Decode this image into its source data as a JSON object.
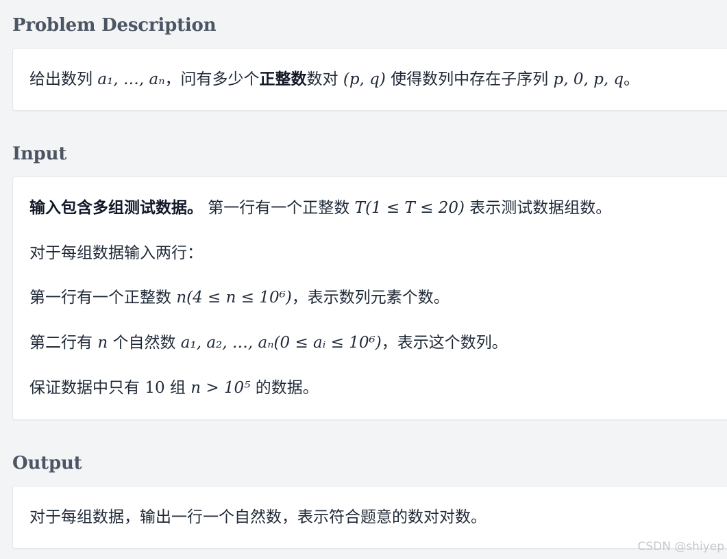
{
  "problem": {
    "title": "Problem Description",
    "text_1": "给出数列 ",
    "math_seq": "a₁, …, aₙ",
    "text_2": "，问有多少个",
    "bold": "正整数",
    "text_3": "数对 ",
    "math_pair": "(p, q)",
    "text_4": " 使得数列中存在子序列 ",
    "math_subseq": "p, 0, p, q",
    "text_5": "。"
  },
  "input": {
    "title": "Input",
    "l1_bold": "输入包含多组测试数据。",
    "l1_text": " 第一行有一个正整数 ",
    "l1_math": "T(1 ≤ T ≤ 20)",
    "l1_text2": " 表示测试数据组数。",
    "l2": "对于每组数据输入两行：",
    "l3_text": "第一行有一个正整数 ",
    "l3_math": "n(4 ≤ n ≤ 10⁶)",
    "l3_text2": "，表示数列元素个数。",
    "l4_text": "第二行有 ",
    "l4_math1": "n",
    "l4_text2": " 个自然数 ",
    "l4_math2": "a₁, a₂, …, aₙ(0 ≤ aᵢ ≤ 10⁶)",
    "l4_text3": "，表示这个数列。",
    "l5_text": "保证数据中只有 ",
    "l5_num": "10",
    "l5_text2": " 组 ",
    "l5_math": "n > 10⁵",
    "l5_text3": " 的数据。"
  },
  "output": {
    "title": "Output",
    "text": "对于每组数据，输出一行一个自然数，表示符合题意的数对对数。"
  },
  "watermark": "CSDN @shiyep"
}
